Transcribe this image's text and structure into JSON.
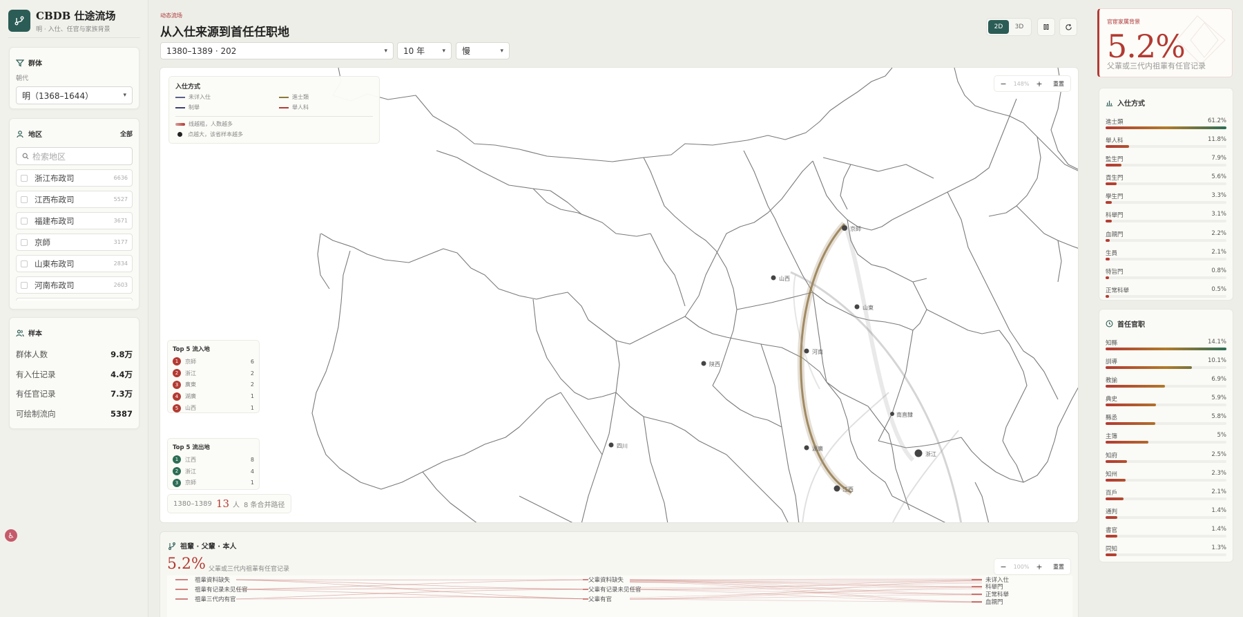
{
  "app": {
    "title": "CBDB 仕途流场",
    "subtitle": "明 · 入仕、任官与家族背景"
  },
  "header": {
    "kicker": "动态流场",
    "title": "从入仕来源到首任任职地"
  },
  "controls": {
    "range": "1380–1389 · 202",
    "window": "10 年",
    "speed": "慢"
  },
  "view": {
    "mode_2d": "2D",
    "mode_3d": "3D"
  },
  "filter_panel": {
    "title": "群体",
    "field_label": "朝代",
    "dynasty": "明（1368–1644）"
  },
  "region_panel": {
    "title": "地区",
    "all_label": "全部",
    "search_placeholder": "检索地区",
    "items": [
      {
        "name": "浙江布政司",
        "count": "6636"
      },
      {
        "name": "江西布政司",
        "count": "5527"
      },
      {
        "name": "福建布政司",
        "count": "3671"
      },
      {
        "name": "京師",
        "count": "3177"
      },
      {
        "name": "山東布政司",
        "count": "2834"
      },
      {
        "name": "河南布政司",
        "count": "2603"
      }
    ]
  },
  "sample_panel": {
    "title": "样本",
    "rows": [
      {
        "label": "群体人数",
        "value": "9.8万"
      },
      {
        "label": "有入仕记录",
        "value": "4.4万"
      },
      {
        "label": "有任官记录",
        "value": "7.3万"
      },
      {
        "label": "可绘制流向",
        "value": "5387"
      }
    ]
  },
  "legend": {
    "title": "入仕方式",
    "items": [
      {
        "label": "未详入仕",
        "color": "#5b5f8a"
      },
      {
        "label": "進士類",
        "color": "#8a7a3a"
      },
      {
        "label": "制舉",
        "color": "#3c3f6e"
      },
      {
        "label": "舉人科",
        "color": "#b33a32"
      }
    ],
    "note_line": "线越粗，人数越多",
    "note_dot": "点越大，该省样本越多"
  },
  "map_zoom": {
    "minus": "−",
    "value": "148%",
    "plus": "+",
    "reset": "重置"
  },
  "map_labels": [
    "京師",
    "山西",
    "山東",
    "河南",
    "陕西",
    "南直隸",
    "浙江",
    "湖廣",
    "江西",
    "四川"
  ],
  "top5_in": {
    "title": "Top 5 流入地",
    "rows": [
      {
        "rank": "1",
        "name": "京師",
        "value": "6"
      },
      {
        "rank": "2",
        "name": "浙江",
        "value": "2"
      },
      {
        "rank": "3",
        "name": "廣東",
        "value": "2"
      },
      {
        "rank": "4",
        "name": "湖廣",
        "value": "1"
      },
      {
        "rank": "5",
        "name": "山西",
        "value": "1"
      }
    ]
  },
  "top5_out": {
    "title": "Top 5 流出地",
    "rows": [
      {
        "rank": "1",
        "name": "江西",
        "value": "8"
      },
      {
        "rank": "2",
        "name": "浙江",
        "value": "4"
      },
      {
        "rank": "3",
        "name": "京師",
        "value": "1"
      }
    ]
  },
  "map_footer": {
    "range": "1380–1389",
    "count": "13",
    "unit": "人",
    "routes": "8 条合并路径"
  },
  "lineage": {
    "title": "祖輩 · 父輩 · 本人",
    "pct": "5.2%",
    "sub": "父輩或三代内祖輩有任官记录",
    "zoom": {
      "minus": "−",
      "value": "100%",
      "plus": "+",
      "reset": "重置"
    },
    "left_nodes": [
      "祖輩資料缺失",
      "祖輩有记录未见任官",
      "祖輩三代内有官"
    ],
    "mid_nodes": [
      "父輩資料缺失",
      "父輩有记录未见任官",
      "父輩有官"
    ],
    "right_nodes": [
      "未详入仕",
      "科舉門",
      "正常科舉",
      "血親門"
    ]
  },
  "hero": {
    "label": "官宦家属背景",
    "value": "5.2%",
    "sub": "父輩或三代内祖輩有任官记录"
  },
  "entry_panel": {
    "title": "入仕方式",
    "rows": [
      {
        "label": "進士類",
        "value": "61.2%",
        "pct": 61.2
      },
      {
        "label": "舉人科",
        "value": "11.8%",
        "pct": 11.8
      },
      {
        "label": "監生門",
        "value": "7.9%",
        "pct": 7.9
      },
      {
        "label": "貢生門",
        "value": "5.6%",
        "pct": 5.6
      },
      {
        "label": "學生門",
        "value": "3.3%",
        "pct": 3.3
      },
      {
        "label": "科舉門",
        "value": "3.1%",
        "pct": 3.1
      },
      {
        "label": "血親門",
        "value": "2.2%",
        "pct": 2.2
      },
      {
        "label": "生員",
        "value": "2.1%",
        "pct": 2.1
      },
      {
        "label": "特旨門",
        "value": "0.8%",
        "pct": 0.8
      },
      {
        "label": "正常科舉",
        "value": "0.5%",
        "pct": 0.5
      }
    ]
  },
  "office_panel": {
    "title": "首任官职",
    "rows": [
      {
        "label": "知縣",
        "value": "14.1%",
        "pct": 14.1
      },
      {
        "label": "訓導",
        "value": "10.1%",
        "pct": 10.1
      },
      {
        "label": "教諭",
        "value": "6.9%",
        "pct": 6.9
      },
      {
        "label": "典史",
        "value": "5.9%",
        "pct": 5.9
      },
      {
        "label": "縣丞",
        "value": "5.8%",
        "pct": 5.8
      },
      {
        "label": "主簿",
        "value": "5%",
        "pct": 5.0
      },
      {
        "label": "知府",
        "value": "2.5%",
        "pct": 2.5
      },
      {
        "label": "知州",
        "value": "2.3%",
        "pct": 2.3
      },
      {
        "label": "百戶",
        "value": "2.1%",
        "pct": 2.1
      },
      {
        "label": "通判",
        "value": "1.4%",
        "pct": 1.4
      },
      {
        "label": "書官",
        "value": "1.4%",
        "pct": 1.4
      },
      {
        "label": "同知",
        "value": "1.3%",
        "pct": 1.3
      }
    ]
  }
}
